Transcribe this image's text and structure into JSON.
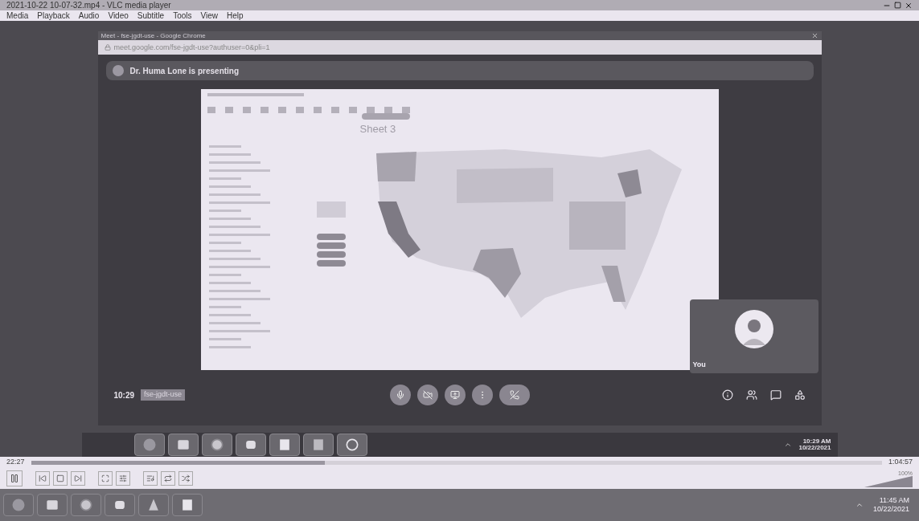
{
  "window": {
    "title": "2021-10-22 10-07-32.mp4 - VLC media player"
  },
  "menu": [
    "Media",
    "Playback",
    "Audio",
    "Video",
    "Subtitle",
    "Tools",
    "View",
    "Help"
  ],
  "browser": {
    "title": "Meet - fse-jgdt-use - Google Chrome",
    "url": "meet.google.com/fse-jgdt-use?authuser=0&pli=1"
  },
  "meet": {
    "banner": "Dr. Huma Lone is presenting",
    "sheet_title": "Sheet 3",
    "self_name": "You",
    "time": "10:29",
    "meeting_code": "fse-jgdt-use"
  },
  "recorded_taskbar": {
    "time": "10:29 AM",
    "date": "10/22/2021"
  },
  "player": {
    "elapsed": "22:27",
    "duration": "1:04:57",
    "level": 0.345,
    "playing": true,
    "volume": {
      "label": "100%",
      "level": 1
    }
  },
  "taskbar": {
    "time": "11:45 AM",
    "date": "10/22/2021"
  }
}
